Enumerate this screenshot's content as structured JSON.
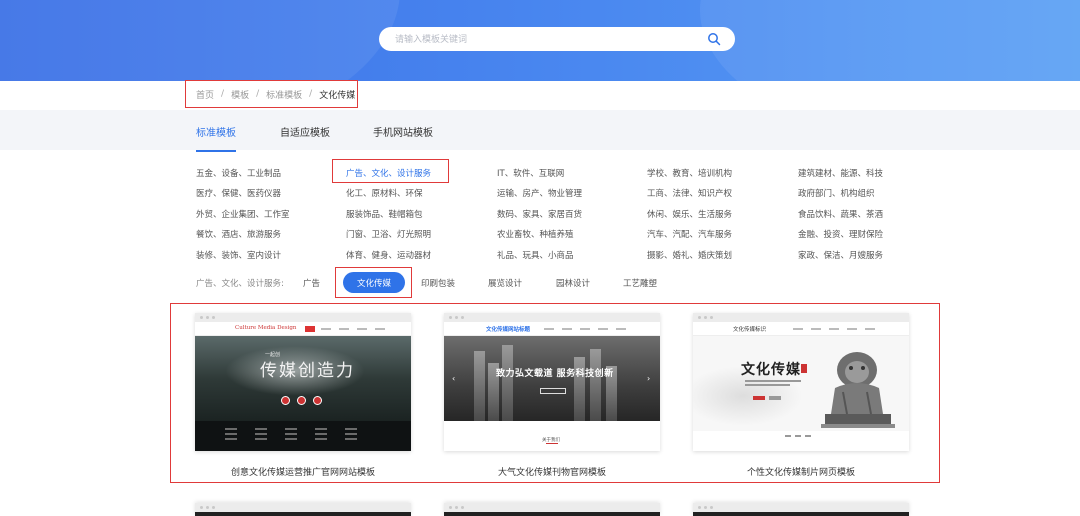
{
  "search": {
    "placeholder": "请输入模板关键词"
  },
  "breadcrumb": {
    "home": "首页",
    "templates": "模板",
    "standard": "标准模板",
    "current": "文化传媒",
    "separator": "/"
  },
  "tabs": [
    {
      "label": "标准模板",
      "active": true
    },
    {
      "label": "自适应模板",
      "active": false
    },
    {
      "label": "手机网站模板",
      "active": false
    }
  ],
  "categories": [
    [
      "五金、设备、工业制品",
      "广告、文化、设计服务",
      "IT、软件、互联网",
      "学校、教育、培训机构",
      "建筑建材、能源、科技"
    ],
    [
      "医疗、保健、医药仪器",
      "化工、原材料、环保",
      "运输、房产、物业管理",
      "工商、法律、知识产权",
      "政府部门、机构组织"
    ],
    [
      "外贸、企业集团、工作室",
      "服装饰品、鞋帽箱包",
      "数码、家具、家居百货",
      "休闲、娱乐、生活服务",
      "食品饮料、蔬果、茶酒"
    ],
    [
      "餐饮、酒店、旅游服务",
      "门窗、卫浴、灯光照明",
      "农业畜牧、种植养殖",
      "汽车、汽配、汽车服务",
      "金融、投资、理财保险"
    ],
    [
      "装修、装饰、室内设计",
      "体育、健身、运动器材",
      "礼品、玩具、小商品",
      "摄影、婚礼、婚庆策划",
      "家政、保洁、月嫂服务"
    ]
  ],
  "subcategory": {
    "label": "广告、文化、设计服务:",
    "items": [
      "广告",
      "文化传媒",
      "印刷包装",
      "展览设计",
      "园林设计",
      "工艺雕塑"
    ],
    "active": "文化传媒"
  },
  "templates": [
    {
      "title": "创意文化传媒运营推广官网网站模板",
      "logo": "Culture Media Design",
      "hero_text": "传媒创造力",
      "hero_small": "一起创"
    },
    {
      "title": "大气文化传媒刊物官网模板",
      "logo": "文化传媒网站标题",
      "hero_text": "致力弘文载道  服务科技创新",
      "section_heading": "关于我们"
    },
    {
      "title": "个性文化传媒制片网页模板",
      "logo": "文化传媒标识",
      "hero_text": "文化传媒"
    }
  ],
  "colors": {
    "accent": "#2f73e8",
    "highlight_box": "#e03a3a",
    "hero_start": "#3a6fe6",
    "hero_end": "#5aa0f4"
  }
}
